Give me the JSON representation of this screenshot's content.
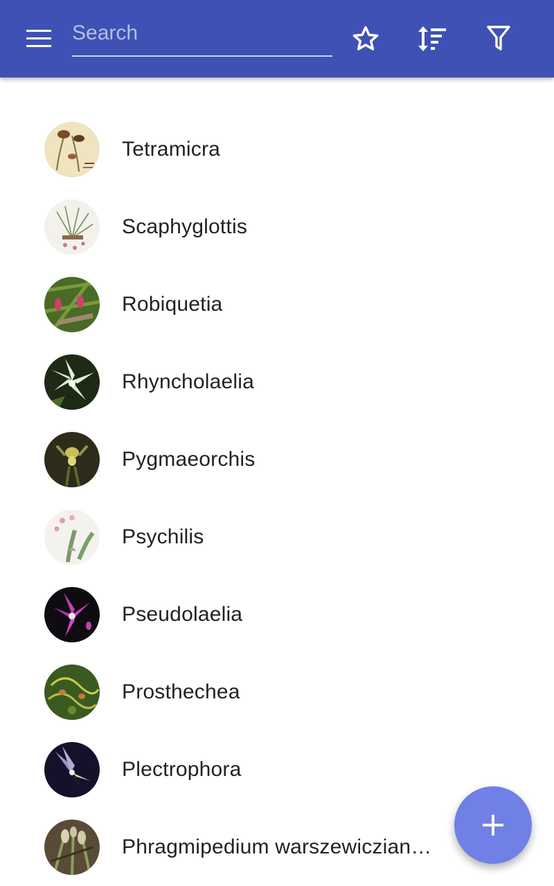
{
  "toolbar": {
    "menu_icon": "menu-icon",
    "search": {
      "placeholder": "Search",
      "value": ""
    },
    "favorites_icon": "star-outline-icon",
    "sort_icon": "sort-icon",
    "filter_icon": "filter-icon",
    "background_color": "#3f51b5"
  },
  "list": {
    "items": [
      {
        "label": "Tetramicra"
      },
      {
        "label": "Scaphyglottis"
      },
      {
        "label": "Robiquetia"
      },
      {
        "label": "Rhyncholaelia"
      },
      {
        "label": "Pygmaeorchis"
      },
      {
        "label": "Psychilis"
      },
      {
        "label": "Pseudolaelia"
      },
      {
        "label": "Prosthechea"
      },
      {
        "label": "Plectrophora"
      },
      {
        "label": "Phragmipedium warszewiczianum"
      }
    ]
  },
  "fab": {
    "icon": "plus-icon",
    "color": "#7080e6"
  }
}
